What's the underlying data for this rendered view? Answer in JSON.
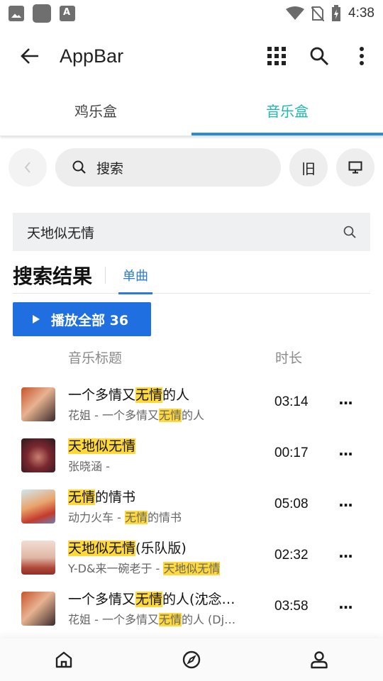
{
  "status_bar": {
    "time": "4:38",
    "left_icons": [
      "image-icon",
      "app-icon",
      "a-icon"
    ],
    "right_icons": [
      "wifi-icon",
      "no-sim-icon",
      "battery-charging-icon"
    ],
    "a_glyph": "A"
  },
  "app_bar": {
    "title": "AppBar",
    "icons": [
      "back-arrow-icon",
      "grid-icon",
      "search-icon",
      "more-vert-icon"
    ]
  },
  "tabs": [
    {
      "label": "鸡乐盒",
      "active": false
    },
    {
      "label": "音乐盒",
      "active": true
    }
  ],
  "search_row": {
    "back_icon": "chevron-left-icon",
    "placeholder": "搜索",
    "old_label": "旧",
    "screen_icon": "monitor-icon"
  },
  "query": {
    "value": "天地似无情"
  },
  "results": {
    "heading": "搜索结果",
    "subtab": "单曲",
    "play_all_label": "播放全部 36",
    "col_title": "音乐标题",
    "col_duration": "时长"
  },
  "songs": [
    {
      "title_pre": "一个多情又",
      "title_hl": "无情",
      "title_post": "的人",
      "sub_pre": "花姐 - 一个多情又",
      "sub_hl": "无情",
      "sub_post": "的人",
      "duration": "03:14",
      "more": "···"
    },
    {
      "title_pre": "",
      "title_hl": "天地似无情",
      "title_post": "",
      "sub_pre": "张晓涵 -",
      "sub_hl": "",
      "sub_post": "",
      "duration": "00:17",
      "more": "···"
    },
    {
      "title_pre": "",
      "title_hl": "无情",
      "title_post": "的情书",
      "sub_pre": "动力火车 - ",
      "sub_hl": "无情",
      "sub_post": "的情书",
      "duration": "05:08",
      "more": "···"
    },
    {
      "title_pre": "",
      "title_hl": "天地似无情",
      "title_post": "(乐队版)",
      "sub_pre": "Y-D&来一碗老于 - ",
      "sub_hl": "天地似无情",
      "sub_post": "",
      "duration": "02:32",
      "more": "···"
    },
    {
      "title_pre": "一个多情又",
      "title_hl": "无情",
      "title_post": "的人(沈念…",
      "sub_pre": "花姐 - 一个多情又",
      "sub_hl": "无情",
      "sub_post": "的人 (Dj…",
      "duration": "03:58",
      "more": "···"
    }
  ],
  "bottom_nav": [
    "home-icon",
    "compass-icon",
    "profile-icon"
  ],
  "colors": {
    "accent_tab_text": "#1fb8b0",
    "accent_indicator": "#2a8bd8",
    "play_button": "#1f6fe0",
    "highlight": "#ffd83a"
  }
}
